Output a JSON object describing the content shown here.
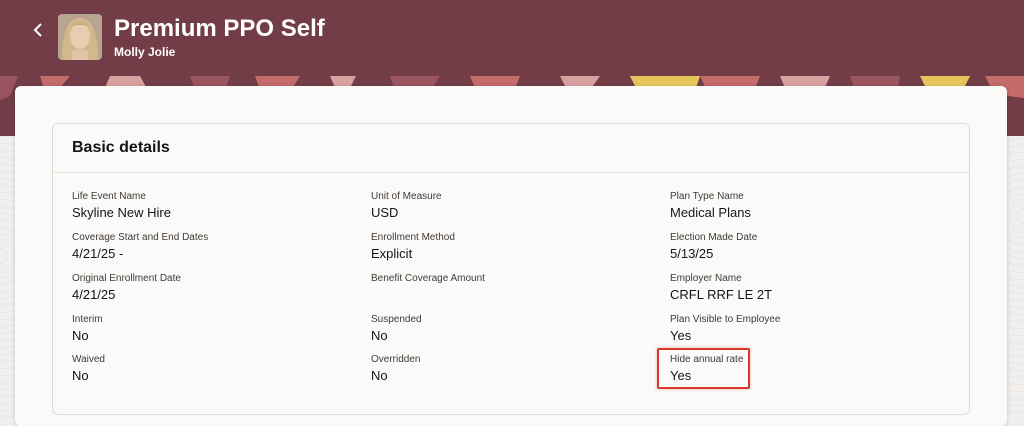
{
  "header": {
    "title": "Premium PPO Self",
    "subtitle": "Molly Jolie",
    "back_icon": "chevron-left-icon",
    "avatar_icon": "user-avatar"
  },
  "colors": {
    "header_bg": "#733d47",
    "highlight": "#d9382e",
    "banner_accents": [
      "#c46b6b",
      "#e6c65c",
      "#9a5460",
      "#d9a0a0"
    ]
  },
  "section": {
    "title": "Basic details",
    "columns": [
      [
        {
          "label": "Life Event Name",
          "value": "Skyline New Hire"
        },
        {
          "label": "Coverage Start and End Dates",
          "value": "4/21/25 -"
        },
        {
          "label": "Original Enrollment Date",
          "value": "4/21/25"
        },
        {
          "label": "Interim",
          "value": "No"
        },
        {
          "label": "Waived",
          "value": "No"
        }
      ],
      [
        {
          "label": "Unit of Measure",
          "value": "USD"
        },
        {
          "label": "Enrollment Method",
          "value": "Explicit"
        },
        {
          "label": "Benefit Coverage Amount",
          "value": ""
        },
        {
          "label": "Suspended",
          "value": "No"
        },
        {
          "label": "Overridden",
          "value": "No"
        }
      ],
      [
        {
          "label": "Plan Type Name",
          "value": "Medical Plans"
        },
        {
          "label": "Election Made Date",
          "value": "5/13/25"
        },
        {
          "label": "Employer Name",
          "value": "CRFL RRF LE 2T"
        },
        {
          "label": "Plan Visible to Employee",
          "value": "Yes"
        },
        {
          "label": "Hide annual rate",
          "value": "Yes"
        }
      ]
    ]
  }
}
